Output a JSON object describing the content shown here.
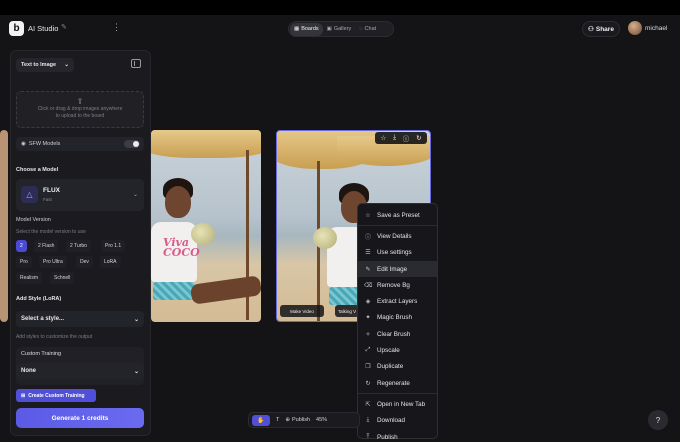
{
  "header": {
    "app_title": "AI Studio",
    "tabs": [
      {
        "label": "Boards",
        "icon": "grid-icon",
        "active": true
      },
      {
        "label": "Gallery",
        "icon": "image-icon",
        "active": false
      },
      {
        "label": "Chat",
        "icon": "chat-icon",
        "active": false
      }
    ],
    "share_label": "Share",
    "username": "michael"
  },
  "panel": {
    "mode": "Text to Image",
    "dropzone_text": "Click or drag & drop images anywhere to upload to the board",
    "sfw_label": "SFW Models",
    "choose_model_label": "Choose a Model",
    "model_name": "FLUX",
    "model_sub": "Fast",
    "model_version_label": "Model Version",
    "model_version_hint": "Select the model version to use",
    "versions": [
      "2",
      "2 Flash",
      "2 Turbo",
      "Pro 1.1",
      "Pro",
      "Pro Ultra",
      "Dev",
      "LoRA",
      "Realism",
      "Schnell"
    ],
    "active_version": "2",
    "add_style_label": "Add Style (LoRA)",
    "style_placeholder": "Select a style...",
    "style_hint": "Add styles to customize the output",
    "custom_training_label": "Custom Training",
    "custom_training_value": "None",
    "create_custom_label": "Create Custom Training",
    "generate_label": "Generate 1 credits"
  },
  "canvas": {
    "image_buttons": [
      "Make Video",
      "Talking V"
    ],
    "shirt_text": "Viva COCO"
  },
  "context_menu": {
    "items": [
      {
        "label": "Save as Preset",
        "icon": "star-icon"
      },
      {
        "label": "View Details",
        "icon": "info-icon"
      },
      {
        "label": "Use settings",
        "icon": "sliders-icon"
      },
      {
        "label": "Edit Image",
        "icon": "edit-icon",
        "highlighted": true
      },
      {
        "label": "Remove Bg",
        "icon": "eraser-icon"
      },
      {
        "label": "Extract Layers",
        "icon": "layers-icon"
      },
      {
        "label": "Magic Brush",
        "icon": "magic-brush-icon"
      },
      {
        "label": "Clear Brush",
        "icon": "clear-brush-icon"
      },
      {
        "label": "Upscale",
        "icon": "expand-icon"
      },
      {
        "label": "Duplicate",
        "icon": "duplicate-icon"
      },
      {
        "label": "Regenerate",
        "icon": "refresh-icon"
      },
      {
        "label": "Open in New Tab",
        "icon": "external-link-icon"
      },
      {
        "label": "Download",
        "icon": "download-icon"
      },
      {
        "label": "Publish",
        "icon": "upload-icon"
      }
    ]
  },
  "bottom_toolbar": {
    "publish_label": "Publish",
    "zoom": "45%"
  },
  "colors": {
    "accent": "#4f4fd8",
    "background": "#141417",
    "panel": "#1b1b1f"
  }
}
